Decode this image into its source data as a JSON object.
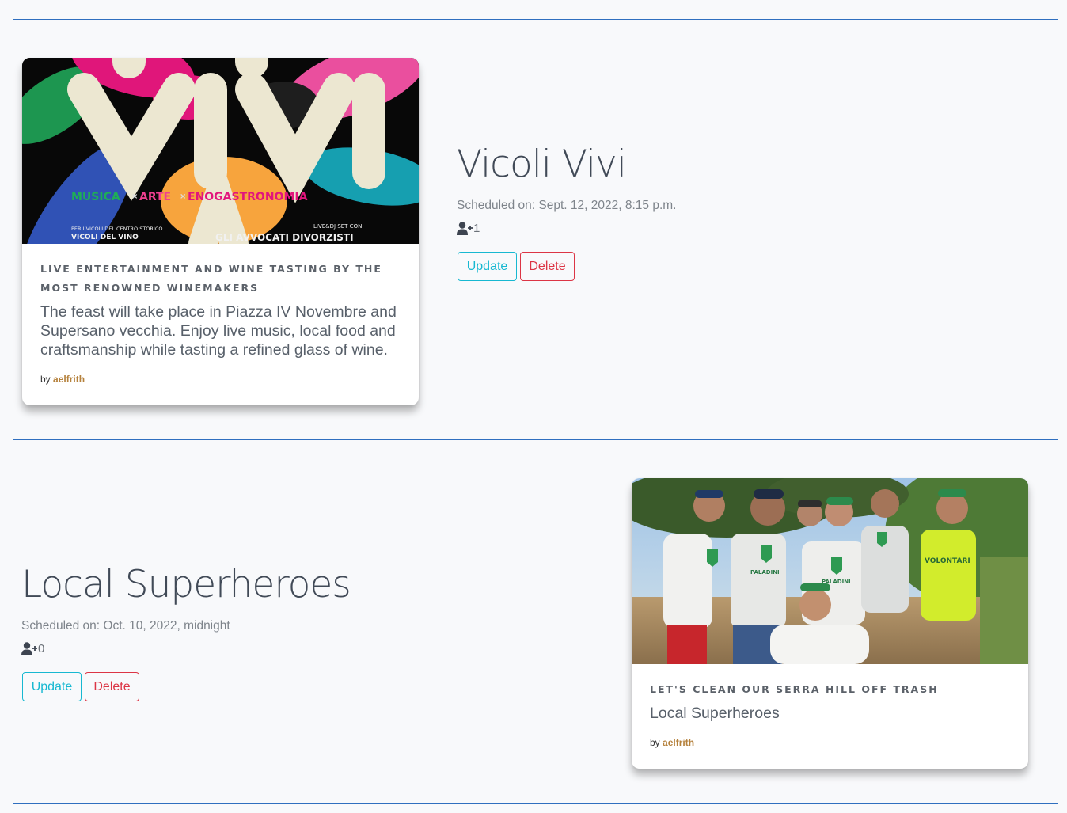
{
  "events": [
    {
      "title": "Vicoli Vivi",
      "scheduled": "Scheduled on: Sept. 12, 2022, 8:15 p.m.",
      "attendees": "1",
      "update_label": "Update",
      "delete_label": "Delete",
      "card": {
        "subtitle": "Live entertainment and wine tasting by the most renowned winemakers",
        "text": "The feast will take place in Piazza IV Novembre and Supersano vecchia. Enjoy live music, local food and craftsmanship while tasting a refined glass of wine.",
        "by_label": "by",
        "author": "aelfrith",
        "poster": {
          "big": "VIVI",
          "musica": "MUSICA",
          "arte": "ARTE",
          "eno": "ENOGASTRONOMIA",
          "cross": "×",
          "small1": "PER I VICOLI DEL CENTRO STORICO",
          "small2": "VICOLI DEL VINO",
          "small3": "LIVE&DJ SET CON",
          "small4": "GLI AVVOCATI DIVORZISTI"
        }
      }
    },
    {
      "title": "Local Superheroes",
      "scheduled": "Scheduled on: Oct. 10, 2022, midnight",
      "attendees": "0",
      "update_label": "Update",
      "delete_label": "Delete",
      "card": {
        "subtitle": "Let's clean our Serra hill off trash",
        "text": "Local Superheroes",
        "by_label": "by",
        "author": "aelfrith",
        "photo": {
          "shirt1": "PALADINI",
          "shirt2": "PALADINI",
          "vest": "VOLONTARI"
        }
      }
    }
  ],
  "colors": {
    "divider": "#2f6fbf",
    "update": "#17b8d1",
    "delete": "#dc3545",
    "author": "#b5813c"
  }
}
